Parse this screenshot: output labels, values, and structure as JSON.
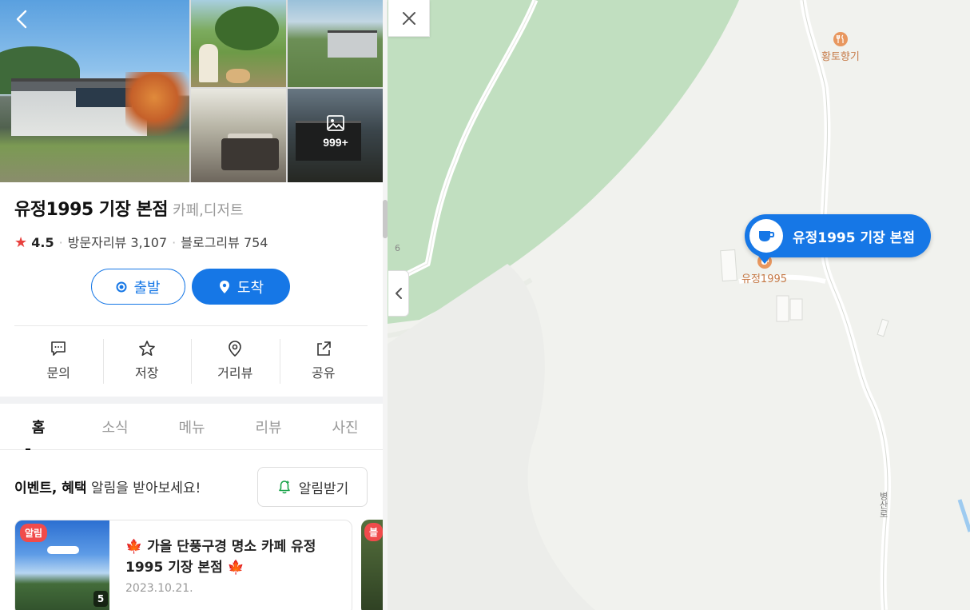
{
  "place": {
    "name": "유정1995 기장 본점",
    "category": "카페,디저트",
    "rating": "4.5",
    "visitor_reviews": "방문자리뷰 3,107",
    "blog_reviews": "블로그리뷰 754",
    "photo_count": "999+"
  },
  "route": {
    "start_label": "출발",
    "dest_label": "도착"
  },
  "actions": [
    {
      "label": "문의",
      "icon": "message-icon"
    },
    {
      "label": "저장",
      "icon": "star-icon"
    },
    {
      "label": "거리뷰",
      "icon": "location-icon"
    },
    {
      "label": "공유",
      "icon": "share-icon"
    }
  ],
  "tabs": [
    "홈",
    "소식",
    "메뉴",
    "리뷰",
    "사진"
  ],
  "active_tab": "홈",
  "notify": {
    "strong": "이벤트, 혜택",
    "rest": " 알림을 받아보세요!",
    "button": "알림받기"
  },
  "news_card": {
    "badge": "알림",
    "title": "🍁 가을 단풍구경 명소 카페 유정1995 기장 본점 🍁",
    "date": "2023.10.21.",
    "image_count": "5"
  },
  "next_card_badge": "블",
  "map": {
    "pin_label": "유정1995 기장 본점",
    "poi_pin": "유정1995",
    "poi_food": "황토향기",
    "road": "병산로",
    "lot_number": "6"
  },
  "colors": {
    "primary": "#1677e6",
    "star": "#e8413e",
    "badge": "#f04b4b",
    "park": "#c1dfc0",
    "poi": "#e8975f"
  }
}
